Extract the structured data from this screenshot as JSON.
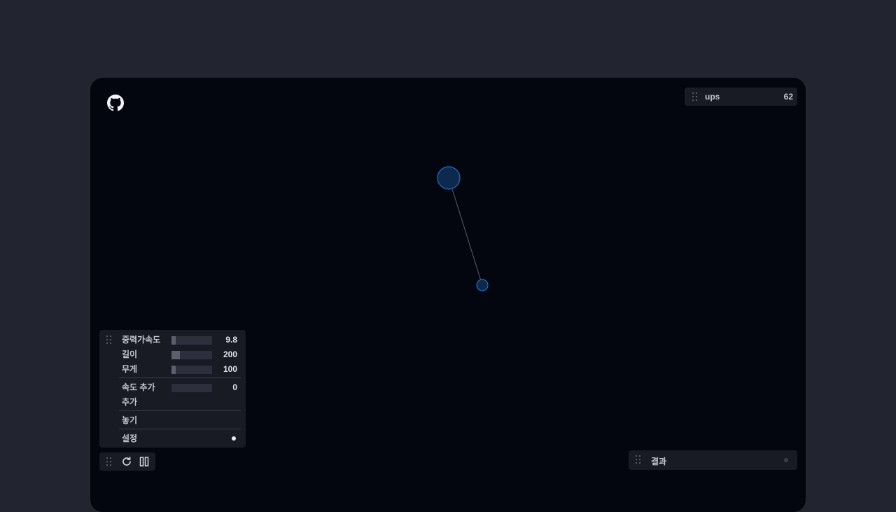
{
  "stats": {
    "label": "ups",
    "value": "62"
  },
  "controls": {
    "gravity": {
      "label": "중력가속도",
      "value": "9.8",
      "level": 0.1
    },
    "length": {
      "label": "길이",
      "value": "200",
      "level": 0.2
    },
    "mass": {
      "label": "무게",
      "value": "100",
      "level": 0.1
    },
    "add_speed": {
      "label": "속도 추가",
      "value": "0",
      "level": 0
    },
    "add_label": "추가",
    "drop_label": "놓기",
    "settings_label": "설정"
  },
  "result": {
    "label": "결과"
  },
  "icons": {
    "github": "github-icon",
    "reset": "refresh-icon",
    "pause": "pause-icon",
    "drag": "drag-handle-icon"
  },
  "colors": {
    "background": "#22242f",
    "stage": "#03050f",
    "bob_fill": "#0d2a4e",
    "bob_stroke": "#1e6fc4"
  }
}
